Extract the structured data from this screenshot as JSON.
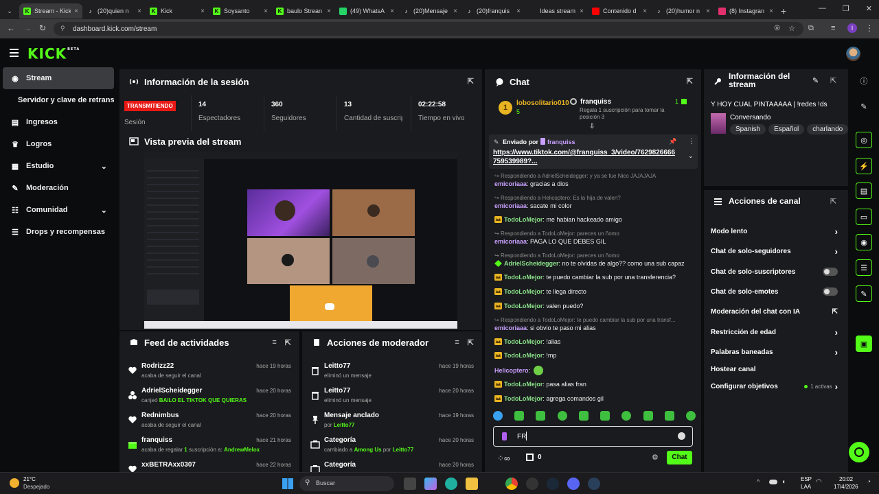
{
  "browser": {
    "tabs": [
      {
        "title": "Stream - Kick",
        "icon": "kick-icon",
        "color": "#53fc18",
        "active": true
      },
      {
        "title": "(20)quien n",
        "icon": "tiktok-icon",
        "color": "#ffffff"
      },
      {
        "title": "Kick",
        "icon": "kick-icon",
        "color": "#53fc18"
      },
      {
        "title": "Soysanto",
        "icon": "kick-icon",
        "color": "#53fc18"
      },
      {
        "title": "baulo Strean",
        "icon": "kick-icon",
        "color": "#53fc18"
      },
      {
        "title": "(49) WhatsA",
        "icon": "whatsapp-icon",
        "color": "#25d366"
      },
      {
        "title": "(20)Mensaje",
        "icon": "tiktok-icon",
        "color": "#ffffff"
      },
      {
        "title": "(20)franquis",
        "icon": "tiktok-icon",
        "color": "#ffffff"
      },
      {
        "title": "Ideas stream",
        "icon": "notion-icon",
        "color": "#ffffff"
      },
      {
        "title": "Contenido d",
        "icon": "youtube-icon",
        "color": "#ff0000"
      },
      {
        "title": "(20)humor n",
        "icon": "tiktok-icon",
        "color": "#ffffff"
      },
      {
        "title": "(8) Instagran",
        "icon": "instagram-icon",
        "color": "#e1306c"
      }
    ],
    "url": "dashboard.kick.com/stream",
    "profile_letter": "I"
  },
  "kick": {
    "logo": "KICK",
    "logo_sup": "BETA"
  },
  "sidebar": {
    "items": [
      {
        "label": "Stream",
        "icon": "stream-icon",
        "selected": true
      },
      {
        "label": "Servidor y clave de retransmisión",
        "icon": ""
      },
      {
        "label": "Ingresos",
        "icon": "income-icon"
      },
      {
        "label": "Logros",
        "icon": "trophy-icon"
      },
      {
        "label": "Estudio",
        "icon": "studio-icon",
        "chevron": true
      },
      {
        "label": "Moderación",
        "icon": "wrench-icon"
      },
      {
        "label": "Comunidad",
        "icon": "community-icon",
        "chevron": true
      },
      {
        "label": "Drops y recompensas",
        "icon": "drops-icon"
      }
    ]
  },
  "session": {
    "title": "Información de la sesión",
    "live_badge": "TRANSMITIENDO",
    "session_label": "Sesión",
    "stats": [
      {
        "value": "14",
        "label": "Espectadores"
      },
      {
        "value": "360",
        "label": "Seguidores"
      },
      {
        "value": "13",
        "label": "Cantidad de suscripciones"
      },
      {
        "value": "02:22:58",
        "label": "Tiempo en vivo"
      }
    ]
  },
  "preview": {
    "title": "Vista previa del stream"
  },
  "activity": {
    "title": "Feed de actividades",
    "rows": [
      {
        "name": "Rodrizz22",
        "desc": "acaba de seguir el canal",
        "time": "hace 19 horas",
        "icon": "heart-icon"
      },
      {
        "name": "AdrielScheidegger",
        "desc_pre": "canjeó ",
        "desc_hl": "BAILO EL TIKTOK QUE QUIERAS",
        "time": "hace 20 horas",
        "icon": "redeem-icon"
      },
      {
        "name": "Rednimbus",
        "desc": "acaba de seguir el canal",
        "time": "hace 20 horas",
        "icon": "heart-icon"
      },
      {
        "name": "franquiss",
        "desc_pre": "acaba de regalar ",
        "desc_hl": "1",
        "desc_mid": " suscripción a: ",
        "desc_user": "AndrewMelox",
        "time": "hace 21 horas",
        "icon": "gift-icon"
      },
      {
        "name": "xxBETRAxx0307",
        "desc": "",
        "time": "hace 22 horas",
        "icon": "heart-icon"
      }
    ]
  },
  "modactions": {
    "title": "Acciones de moderador",
    "rows": [
      {
        "name": "Leitto77",
        "desc": "eliminó un mensaje",
        "time": "hace 19 horas",
        "icon": "trash-icon"
      },
      {
        "name": "Leitto77",
        "desc": "eliminó un mensaje",
        "time": "hace 20 horas",
        "icon": "trash-icon"
      },
      {
        "name": "Mensaje anclado",
        "desc_pre": "por ",
        "desc_hl": "Leitto77",
        "time": "hace 19 horas",
        "icon": "pin-icon"
      },
      {
        "name": "Categoría",
        "desc_pre": "cambiado a ",
        "desc_hl": "Among Us",
        "desc_mid": " por ",
        "desc_user": "Leitto77",
        "time": "hace 20 horas",
        "icon": "category-icon"
      },
      {
        "name": "Categoría",
        "desc": "",
        "time": "hace 20 horas",
        "icon": "category-icon"
      }
    ]
  },
  "chat": {
    "title": "Chat",
    "goal": {
      "rank": "1",
      "user": "lobosolitario010",
      "count": "5",
      "streamer": "franquiss",
      "gift_count": "1",
      "desc": "Regala 1 suscripción para tomar la posición 3"
    },
    "pinned": {
      "label": "Enviado por",
      "user": "franquiss",
      "link": "https://www.tiktok.com/@franquiss_3/video/7629826666759539989?..."
    },
    "messages": [
      {
        "reply": "Respondiendo a AdrielScheidegger: y ya se fue Nico JAJAJAJA"
      },
      {
        "user": "emicoriaaa",
        "color": "#c9a0ff",
        "text": "gracias a dios"
      },
      {
        "reply": "Respondiendo a Helicoptero: Es la hija de valen?"
      },
      {
        "user": "emicoriaaa",
        "color": "#c9a0ff",
        "text": "sacate mi color"
      },
      {
        "user": "TodoLoMejor",
        "color": "#8be28b",
        "badge": "crown",
        "text": "me habian hackeado amigo"
      },
      {
        "reply": "Respondiendo a TodoLoMejor: pareces un ñomo"
      },
      {
        "user": "emicoriaaa",
        "color": "#c9a0ff",
        "text": "PAGA LO QUE DEBES GIL"
      },
      {
        "reply": "Respondiendo a TodoLoMejor: pareces un ñomo"
      },
      {
        "user": "AdrielScheidegger",
        "color": "#8be28b",
        "badge": "diamond",
        "text": "no te olvidas de algo?? como una sub capaz"
      },
      {
        "user": "TodoLoMejor",
        "color": "#8be28b",
        "badge": "crown",
        "text": "te puedo cambiar la sub por una transferencia?"
      },
      {
        "user": "TodoLoMejor",
        "color": "#8be28b",
        "badge": "crown",
        "text": "te llega directo"
      },
      {
        "user": "TodoLoMejor",
        "color": "#8be28b",
        "badge": "crown",
        "text": "valen puedo?"
      },
      {
        "reply": "Respondiendo a TodoLoMejor: te puedo cambiar la sub por una transf..."
      },
      {
        "user": "emicoriaaa",
        "color": "#c9a0ff",
        "text": "si obvio te paso mi alias"
      },
      {
        "user": "TodoLoMejor",
        "color": "#8be28b",
        "badge": "crown",
        "text": "!alias"
      },
      {
        "user": "TodoLoMejor",
        "color": "#8be28b",
        "badge": "crown",
        "text": "!mp"
      },
      {
        "user": "Helicoptero",
        "color": "#c9a0ff",
        "text": "",
        "emote": true
      },
      {
        "user": "TodoLoMejor",
        "color": "#8be28b",
        "badge": "crown",
        "text": "pasa alias fran"
      },
      {
        "user": "TodoLoMejor",
        "color": "#8be28b",
        "badge": "crown",
        "text": "agrega comandos gil"
      }
    ],
    "input_value": "FR",
    "points": "0",
    "send_label": "Chat"
  },
  "streaminfo": {
    "title": "Información del stream",
    "stream_title": "Y HOY CUAL PINTAAAAA | !redes !ds",
    "category": "Conversando",
    "tags": [
      "Spanish",
      "Español",
      "charlando"
    ]
  },
  "channel": {
    "title": "Acciones de canal",
    "rows": [
      {
        "label": "Modo lento",
        "ctrl": "chevron"
      },
      {
        "label": "Chat de solo-seguidores",
        "ctrl": "chevron"
      },
      {
        "label": "Chat de solo-suscriptores",
        "ctrl": "toggle"
      },
      {
        "label": "Chat de solo-emotes",
        "ctrl": "toggle"
      },
      {
        "label": "Moderación del chat con IA",
        "ctrl": "external"
      },
      {
        "label": "Restricción de edad",
        "ctrl": "chevron"
      },
      {
        "label": "Palabras baneadas",
        "ctrl": "chevron"
      },
      {
        "label": "Hostear canal",
        "ctrl": "none"
      },
      {
        "label": "Configurar objetivos",
        "ctrl": "chevron",
        "extra": "1 activas"
      }
    ]
  },
  "taskbar": {
    "weather_temp": "21°C",
    "weather_desc": "Despejado",
    "search_placeholder": "Buscar",
    "lang_top": "ESP",
    "lang_bot": "LAA",
    "time": "20:02",
    "date": "17/4/2026"
  },
  "colors": {
    "accent": "#53fc18",
    "live": "#e91916",
    "panel": "#1a1b1e"
  }
}
